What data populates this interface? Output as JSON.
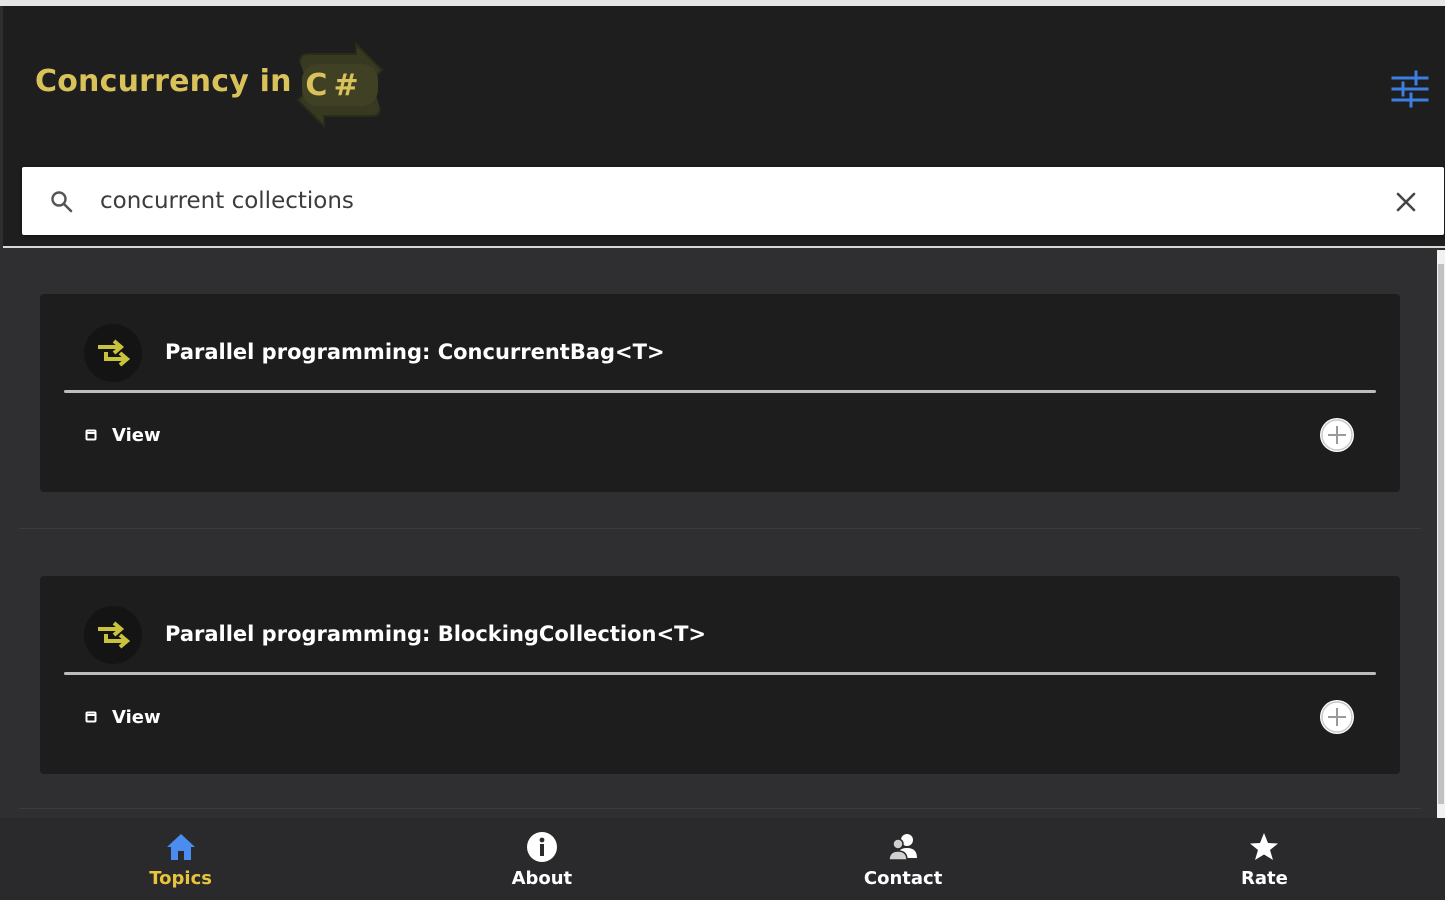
{
  "header": {
    "title": "Concurrency in",
    "logo_text": "C#",
    "settings_icon": "sliders-icon"
  },
  "search": {
    "value": "concurrent collections",
    "search_icon": "search-icon",
    "clear_icon": "close-icon"
  },
  "results": [
    {
      "title": "Parallel programming: ConcurrentBag<T>",
      "icon": "swap-arrows-icon",
      "view_label": "View",
      "add_icon": "plus-circle-icon"
    },
    {
      "title": "Parallel programming: BlockingCollection<T>",
      "icon": "swap-arrows-icon",
      "view_label": "View",
      "add_icon": "plus-circle-icon"
    }
  ],
  "nav": {
    "items": [
      {
        "label": "Topics",
        "icon": "home-icon",
        "active": true
      },
      {
        "label": "About",
        "icon": "info-icon",
        "active": false
      },
      {
        "label": "Contact",
        "icon": "contact-icon",
        "active": false
      },
      {
        "label": "Rate",
        "icon": "star-icon",
        "active": false
      }
    ]
  },
  "colors": {
    "accent_yellow": "#d9c25a",
    "active_nav": "#e8c43a",
    "home_icon_blue": "#4a8cf0",
    "header_bg": "#1e1e1f",
    "card_bg": "#1d1d1e",
    "content_bg": "#2f2f31"
  }
}
